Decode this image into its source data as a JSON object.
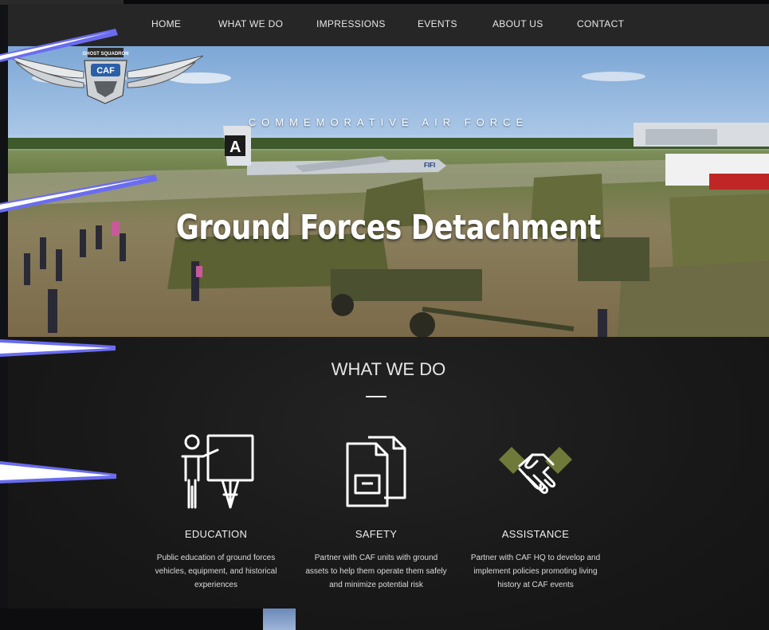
{
  "nav": {
    "items": [
      "HOME",
      "WHAT WE DO",
      "IMPRESSIONS",
      "EVENTS",
      "ABOUT US",
      "CONTACT"
    ]
  },
  "hero": {
    "logo_top": "GHOST SQUADRON",
    "logo_badge": "CAF",
    "brand": "COMMEMORATIVE AIR FORCE",
    "title": "Ground Forces Detachment",
    "plane_tail": "A",
    "plane_nose": "FIFI"
  },
  "what_we_do": {
    "title": "WHAT WE DO",
    "columns": [
      {
        "icon": "presentation-board-icon",
        "heading": "EDUCATION",
        "desc": "Public education of ground forces vehicles, equipment, and historical experiences"
      },
      {
        "icon": "document-icon",
        "heading": "SAFETY",
        "desc": "Partner with CAF units with ground assets to help them operate them safely and minimize potential risk"
      },
      {
        "icon": "handshake-icon",
        "heading": "ASSISTANCE",
        "desc": "Partner with CAF HQ to develop and implement policies promoting living history at CAF events"
      }
    ]
  },
  "colors": {
    "accent_arrow": "#6a6cf0",
    "nav_bg": "#262626",
    "section_bg": "#181818",
    "handshake": "#6f7a3a"
  }
}
